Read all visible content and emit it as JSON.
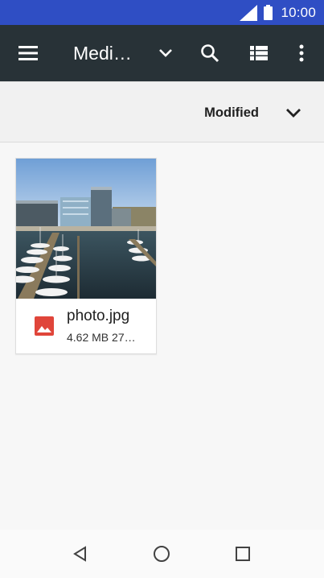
{
  "status_bar": {
    "time": "10:00",
    "icons": [
      "signal-icon",
      "battery-icon"
    ]
  },
  "toolbar": {
    "title": "Medi…",
    "icons": [
      "menu-icon",
      "chevron-down-icon",
      "search-icon",
      "list-view-icon",
      "more-vert-icon"
    ]
  },
  "sort_bar": {
    "label": "Modified",
    "icon": "chevron-down-icon"
  },
  "files": [
    {
      "name": "photo.jpg",
      "meta": "4.62 MB 27…",
      "type_icon": "image-icon",
      "type_icon_color": "#e0453a"
    }
  ],
  "nav_bar": {
    "icons": [
      "back-icon",
      "home-icon",
      "recents-icon"
    ]
  },
  "colors": {
    "status_bar": "#2f4ec4",
    "toolbar": "#283237",
    "background": "#f7f7f7"
  }
}
